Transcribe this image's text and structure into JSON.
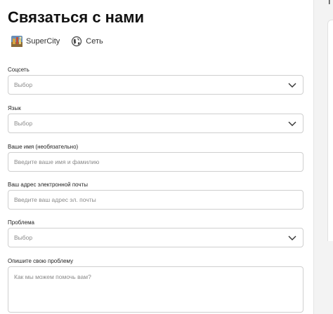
{
  "header": {
    "title": "Связаться с нами"
  },
  "tags": [
    {
      "label": "SuperCity",
      "icon": "app-thumbnail-icon"
    },
    {
      "label": "Сеть",
      "icon": "globe-icon"
    }
  ],
  "form": {
    "social": {
      "label": "Соцсеть",
      "placeholder": "Выбор"
    },
    "language": {
      "label": "Язык",
      "placeholder": "Выбор"
    },
    "name": {
      "label": "Ваше имя (необязательно)",
      "placeholder": "Введите ваше имя и фамилию"
    },
    "email": {
      "label": "Ваш адрес электронной почты",
      "placeholder": "Введите ваш адрес эл. почты"
    },
    "problem": {
      "label": "Проблема",
      "placeholder": "Выбор"
    },
    "description": {
      "label": "Опишите свою проблему",
      "placeholder": "Как мы можем помочь вам?"
    }
  },
  "side": {
    "char": "П"
  }
}
